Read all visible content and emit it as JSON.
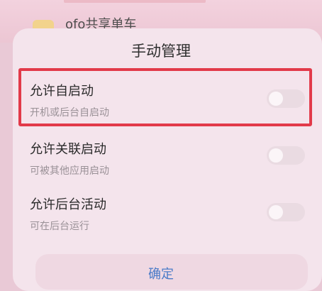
{
  "background_app": {
    "name": "ofo共享单车"
  },
  "dialog": {
    "title": "手动管理",
    "items": [
      {
        "title": "允许自启动",
        "subtitle": "开机或后台自启动",
        "enabled": false,
        "highlighted": true
      },
      {
        "title": "允许关联启动",
        "subtitle": "可被其他应用启动",
        "enabled": false,
        "highlighted": false
      },
      {
        "title": "允许后台活动",
        "subtitle": "可在后台运行",
        "enabled": false,
        "highlighted": false
      }
    ],
    "confirm_label": "确定"
  },
  "colors": {
    "highlight_border": "#e23a4a",
    "confirm_text": "#4a7bc8",
    "dialog_bg": "#f4e4ec"
  }
}
